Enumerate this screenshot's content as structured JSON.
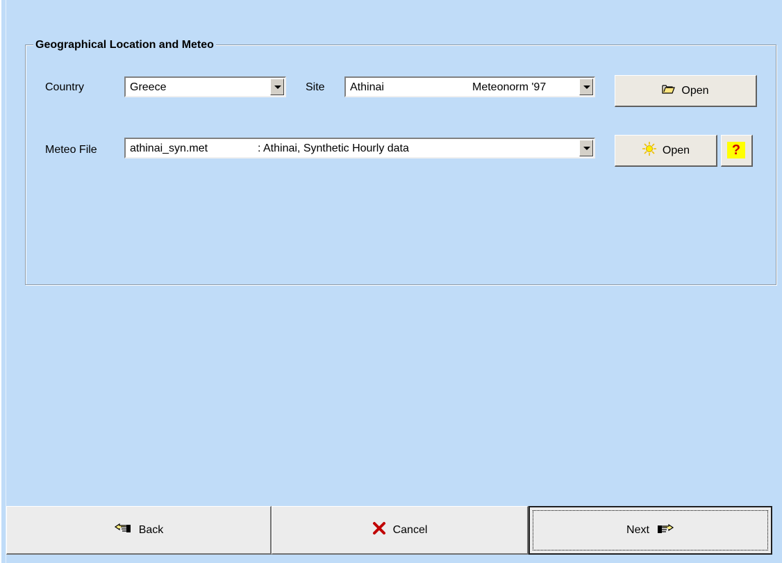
{
  "group": {
    "title": "Geographical Location and Meteo"
  },
  "country": {
    "label": "Country",
    "value": "Greece"
  },
  "site": {
    "label": "Site",
    "value": "Athinai",
    "source": "Meteonorm '97"
  },
  "site_open_button": {
    "label": "Open",
    "icon": "folder-open-icon"
  },
  "meteo": {
    "label": "Meteo File",
    "file": "athinai_syn.met",
    "description": ": Athinai, Synthetic Hourly data"
  },
  "meteo_open_button": {
    "label": "Open",
    "icon": "sun-icon"
  },
  "help_button": {
    "label": "?"
  },
  "footer": {
    "back_label": "Back",
    "cancel_label": "Cancel",
    "next_label": "Next"
  },
  "colors": {
    "background": "#c0dcf8",
    "button": "#ececec",
    "help_bg": "#ffff00",
    "help_fg": "#d00000",
    "cancel_x": "#c00000"
  }
}
